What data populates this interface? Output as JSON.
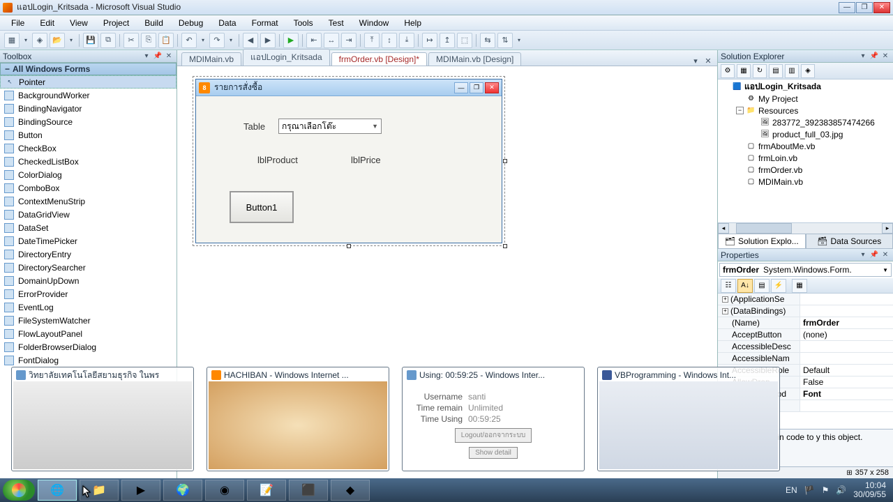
{
  "window": {
    "title": "แอปLogin_Kritsada - Microsoft Visual Studio"
  },
  "menus": [
    "File",
    "Edit",
    "View",
    "Project",
    "Build",
    "Debug",
    "Data",
    "Format",
    "Tools",
    "Test",
    "Window",
    "Help"
  ],
  "toolbox": {
    "title": "Toolbox",
    "category": "All Windows Forms",
    "items": [
      "Pointer",
      "BackgroundWorker",
      "BindingNavigator",
      "BindingSource",
      "Button",
      "CheckBox",
      "CheckedListBox",
      "ColorDialog",
      "ComboBox",
      "ContextMenuStrip",
      "DataGridView",
      "DataSet",
      "DateTimePicker",
      "DirectoryEntry",
      "DirectorySearcher",
      "DomainUpDown",
      "ErrorProvider",
      "EventLog",
      "FileSystemWatcher",
      "FlowLayoutPanel",
      "FolderBrowserDialog",
      "FontDialog"
    ]
  },
  "tabs": {
    "items": [
      "MDIMain.vb",
      "แอปLogin_Kritsada",
      "frmOrder.vb [Design]*",
      "MDIMain.vb [Design]"
    ],
    "activeIndex": 2
  },
  "form": {
    "title": "รายการสั่งซื้อ",
    "tableLabel": "Table",
    "comboText": "กรุณาเลือกโต๊ะ",
    "lblProduct": "lblProduct",
    "lblPrice": "lblPrice",
    "button1": "Button1"
  },
  "solution": {
    "title": "Solution Explorer",
    "root": "แอปLogin_Kritsada",
    "myproject": "My Project",
    "resources": "Resources",
    "res1": "283772_392383857474266",
    "res2": "product_full_03.jpg",
    "f1": "frmAboutMe.vb",
    "f2": "frmLoin.vb",
    "f3": "frmOrder.vb",
    "f4": "MDIMain.vb",
    "bottabs": {
      "explorer": "Solution Explo...",
      "datasources": "Data Sources"
    }
  },
  "properties": {
    "title": "Properties",
    "object": "frmOrder",
    "objectType": "System.Windows.Form.",
    "rows": [
      {
        "k": "(ApplicationSe",
        "v": "",
        "exp": true
      },
      {
        "k": "(DataBindings)",
        "v": "",
        "exp": true
      },
      {
        "k": "(Name)",
        "v": "frmOrder",
        "bold": true
      },
      {
        "k": "AcceptButton",
        "v": "(none)"
      },
      {
        "k": "AccessibleDesc",
        "v": ""
      },
      {
        "k": "AccessibleNam",
        "v": ""
      },
      {
        "k": "AccessibleRole",
        "v": "Default"
      },
      {
        "k": "AllowDrop",
        "v": "False"
      },
      {
        "k": "AutoScaleMod",
        "v": "Font",
        "bold": true
      },
      {
        "k": "",
        "v": ""
      }
    ],
    "descHint": "he name used in code to y this object.",
    "status": "357 x 258"
  },
  "previews": {
    "p1": "วิทยาลัยเทคโนโลยีสยามธุรกิจ ในพร",
    "p2": "HACHIBAN - Windows Internet ...",
    "p3": "Using: 00:59:25 - Windows Inter...",
    "p4": "VBProgramming - Windows Int...",
    "using": {
      "username_l": "Username",
      "username_v": "santi",
      "remain_l": "Time remain",
      "remain_v": "Unlimited",
      "using_l": "Time Using",
      "using_v": "00:59:25",
      "logout": "Logout/ออกจากระบบ",
      "detail": "Show detail"
    }
  },
  "taskbar": {
    "lang": "EN",
    "time": "10:04",
    "date": "30/09/55"
  }
}
